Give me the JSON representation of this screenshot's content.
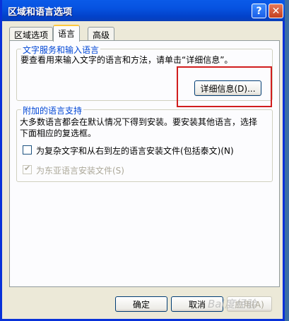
{
  "window": {
    "title": "区域和语言选项",
    "help_glyph": "?",
    "close_glyph": "✕"
  },
  "tabs": [
    {
      "label": "区域选项",
      "active": false
    },
    {
      "label": "语言",
      "active": true
    },
    {
      "label": "高级",
      "active": false
    }
  ],
  "text_services": {
    "title": "文字服务和输入语言",
    "description": "要查看用来输入文字的语言和方法，请单击“详细信息”。",
    "details_button": "详细信息(D)..."
  },
  "supplemental": {
    "title": "附加的语言支持",
    "description_line1": "大多数语言都会在默认情况下得到安装。要安装其他语言，选择",
    "description_line2": "下面相应的复选框。",
    "complex_scripts_label": "为复杂文字和从右到左的语言安装文件(包括泰文)(N)",
    "complex_scripts_checked": false,
    "east_asian_label": "为东亚语言安装文件(S)",
    "east_asian_checked": true,
    "east_asian_enabled": false
  },
  "footer": {
    "ok": "确定",
    "cancel": "取消",
    "apply": "应用(A)"
  },
  "annotation": {
    "color": "#d11d1d"
  },
  "watermark": "Bai度经验"
}
